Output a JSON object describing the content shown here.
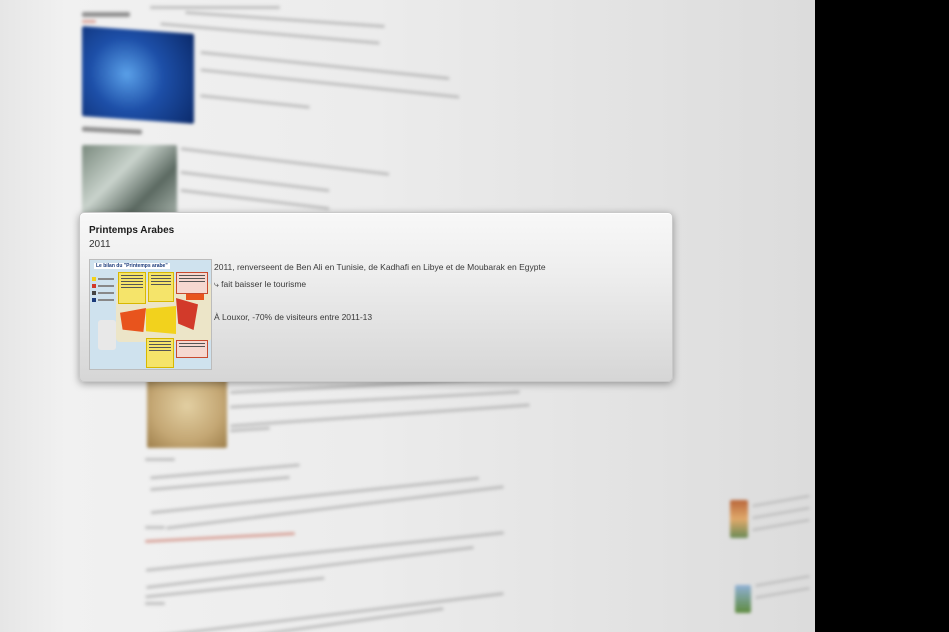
{
  "card": {
    "title": "Printemps Arabes",
    "year": "2011",
    "map_title": "Le bilan du \"Printemps arabe\"",
    "lines": [
      "2011, renverseent de Ben Ali en Tunisie, de Kadhafi en Libye et de Moubarak en Egypte",
      "⤷ fait baisser le tourisme",
      "À Louxor, -70% de visiteurs entre 2011-13"
    ]
  },
  "colors": {
    "page_bg": "#ececec",
    "card_bg": "#eeeeee",
    "map_orange": "#e8541d",
    "map_yellow": "#f2d21d",
    "map_red": "#d23a2a",
    "sea": "#cfe2ee"
  }
}
